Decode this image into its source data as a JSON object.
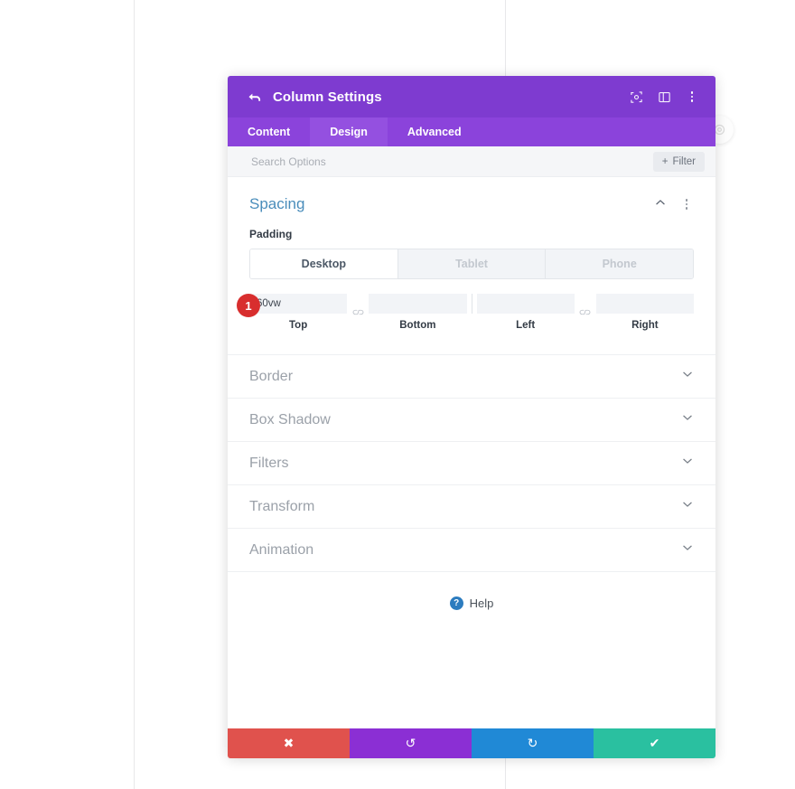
{
  "window": {
    "title": "Column Settings"
  },
  "header": {
    "back_icon": "back-arrow-icon",
    "icons": [
      {
        "name": "focus-target-icon"
      },
      {
        "name": "layout-panel-icon"
      },
      {
        "name": "more-vertical-icon"
      }
    ]
  },
  "tabs": [
    {
      "label": "Content",
      "active": false
    },
    {
      "label": "Design",
      "active": true
    },
    {
      "label": "Advanced",
      "active": false
    }
  ],
  "search": {
    "placeholder": "Search Options",
    "value": "",
    "filter_label": "Filter",
    "filter_plus": "+"
  },
  "spacing": {
    "title": "Spacing",
    "collapse_icon": "chevron-up-icon",
    "menu_icon": "more-vertical-icon",
    "padding_label": "Padding",
    "devices": [
      {
        "label": "Desktop",
        "active": true
      },
      {
        "label": "Tablet",
        "active": false
      },
      {
        "label": "Phone",
        "active": false
      }
    ],
    "fields": [
      {
        "caption": "Top",
        "value": "60vw"
      },
      {
        "caption": "Bottom",
        "value": ""
      },
      {
        "caption": "Left",
        "value": ""
      },
      {
        "caption": "Right",
        "value": ""
      }
    ],
    "link_icon_label": "⊂⁄⊃",
    "badge": "1"
  },
  "sections": [
    {
      "label": "Border"
    },
    {
      "label": "Box Shadow"
    },
    {
      "label": "Filters"
    },
    {
      "label": "Transform"
    },
    {
      "label": "Animation"
    }
  ],
  "help": {
    "symbol": "?",
    "label": "Help"
  },
  "footer": {
    "buttons": [
      {
        "name": "cancel-button",
        "glyph": "✖"
      },
      {
        "name": "undo-button",
        "glyph": "↺"
      },
      {
        "name": "redo-button",
        "glyph": "↻"
      },
      {
        "name": "save-button",
        "glyph": "✔"
      }
    ]
  },
  "colors": {
    "header_purple": "#7e3bd0",
    "tab_purple": "#8b43db",
    "tab_active_purple": "#9450e0",
    "section_title_blue": "#4a8dbb",
    "badge_red": "#d82e2e",
    "cancel_red": "#e0524d",
    "undo_purple": "#8b2fd4",
    "redo_blue": "#2089d6",
    "save_green": "#2ac0a0",
    "help_blue": "#2c7cbf"
  }
}
